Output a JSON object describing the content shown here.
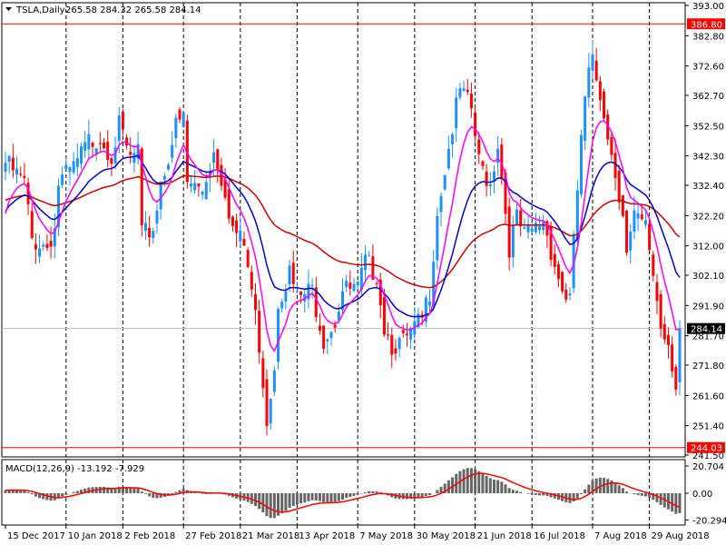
{
  "header": {
    "symbol": "TSLA,Daily",
    "ohlc": "265.58 284.32 265.58 284.14"
  },
  "macd_label": "MACD(12,26,9) -13.192 -7.929",
  "chart_data": {
    "type": "candlestick",
    "title": "TSLA,Daily",
    "ylim": [
      241.5,
      393.0
    ],
    "y_ticks": [
      "393.00",
      "382.80",
      "372.60",
      "362.70",
      "352.50",
      "342.30",
      "332.40",
      "322.20",
      "312.00",
      "302.10",
      "291.90",
      "281.70",
      "271.80",
      "261.60",
      "251.40",
      "241.50"
    ],
    "y_tick_values": [
      393.0,
      382.8,
      372.6,
      362.7,
      352.5,
      342.3,
      332.4,
      322.2,
      312.0,
      302.1,
      291.9,
      281.7,
      271.8,
      261.6,
      251.4,
      241.5
    ],
    "x_ticks": [
      "15 Dec 2017",
      "10 Jan 2018",
      "2 Feb 2018",
      "27 Feb 2018",
      "21 Mar 2018",
      "13 Apr 2018",
      "7 May 2018",
      "30 May 2018",
      "21 Jun 2018",
      "16 Jul 2018",
      "7 Aug 2018",
      "29 Aug 2018"
    ],
    "x_tick_bars": [
      0,
      16,
      31,
      47,
      62,
      77,
      93,
      108,
      124,
      139,
      155,
      170
    ],
    "bar_count": 179,
    "close_anchors": [
      [
        0,
        340
      ],
      [
        5,
        333
      ],
      [
        7,
        314
      ],
      [
        11,
        312
      ],
      [
        13,
        318
      ],
      [
        14,
        333
      ],
      [
        18,
        338
      ],
      [
        22,
        347
      ],
      [
        25,
        349
      ],
      [
        28,
        343
      ],
      [
        30,
        352
      ],
      [
        33,
        341
      ],
      [
        35,
        344
      ],
      [
        36,
        315
      ],
      [
        39,
        318
      ],
      [
        41,
        333
      ],
      [
        45,
        352
      ],
      [
        47,
        355
      ],
      [
        48,
        333
      ],
      [
        52,
        331
      ],
      [
        55,
        344
      ],
      [
        58,
        331
      ],
      [
        60,
        318
      ],
      [
        63,
        312
      ],
      [
        65,
        297
      ],
      [
        67,
        279
      ],
      [
        69,
        254
      ],
      [
        71,
        272
      ],
      [
        72,
        294
      ],
      [
        75,
        303
      ],
      [
        77,
        294
      ],
      [
        81,
        297
      ],
      [
        84,
        281
      ],
      [
        87,
        287
      ],
      [
        89,
        297
      ],
      [
        93,
        297
      ],
      [
        95,
        306
      ],
      [
        98,
        303
      ],
      [
        100,
        285
      ],
      [
        102,
        279
      ],
      [
        105,
        279
      ],
      [
        107,
        282
      ],
      [
        110,
        287
      ],
      [
        112,
        297
      ],
      [
        114,
        324
      ],
      [
        118,
        352
      ],
      [
        120,
        364
      ],
      [
        123,
        358
      ],
      [
        125,
        340
      ],
      [
        128,
        333
      ],
      [
        130,
        347
      ],
      [
        133,
        312
      ],
      [
        135,
        321
      ],
      [
        137,
        315
      ],
      [
        140,
        318
      ],
      [
        142,
        321
      ],
      [
        145,
        306
      ],
      [
        147,
        297
      ],
      [
        149,
        294
      ],
      [
        152,
        349
      ],
      [
        154,
        370
      ],
      [
        155,
        373
      ],
      [
        158,
        358
      ],
      [
        160,
        343
      ],
      [
        163,
        324
      ],
      [
        164,
        309
      ],
      [
        166,
        321
      ],
      [
        169,
        318
      ],
      [
        171,
        303
      ],
      [
        173,
        285
      ],
      [
        175,
        280
      ],
      [
        177,
        266
      ],
      [
        178,
        284.14
      ]
    ],
    "horizontal_lines": [
      {
        "value": 386.8,
        "label": "386.80",
        "color": "#ff0000"
      },
      {
        "value": 244.03,
        "label": "244.03",
        "color": "#ff0000"
      }
    ],
    "last_price": {
      "value": 284.14,
      "label": "284.14"
    },
    "macd": {
      "params": "12,26,9",
      "ylim": [
        -20.294,
        20.704
      ],
      "y_ticks": [
        "20.704",
        "0.00",
        "-20.294"
      ],
      "macd": -13.192,
      "signal": -7.929
    },
    "colors": {
      "up": "#1e90ff",
      "down": "#ff0000",
      "ma_fast": "#ff00ff",
      "ma_mid": "#0000cc",
      "ma_slow": "#cc0000",
      "hist": "#666666",
      "signal": "#ff0000"
    }
  }
}
